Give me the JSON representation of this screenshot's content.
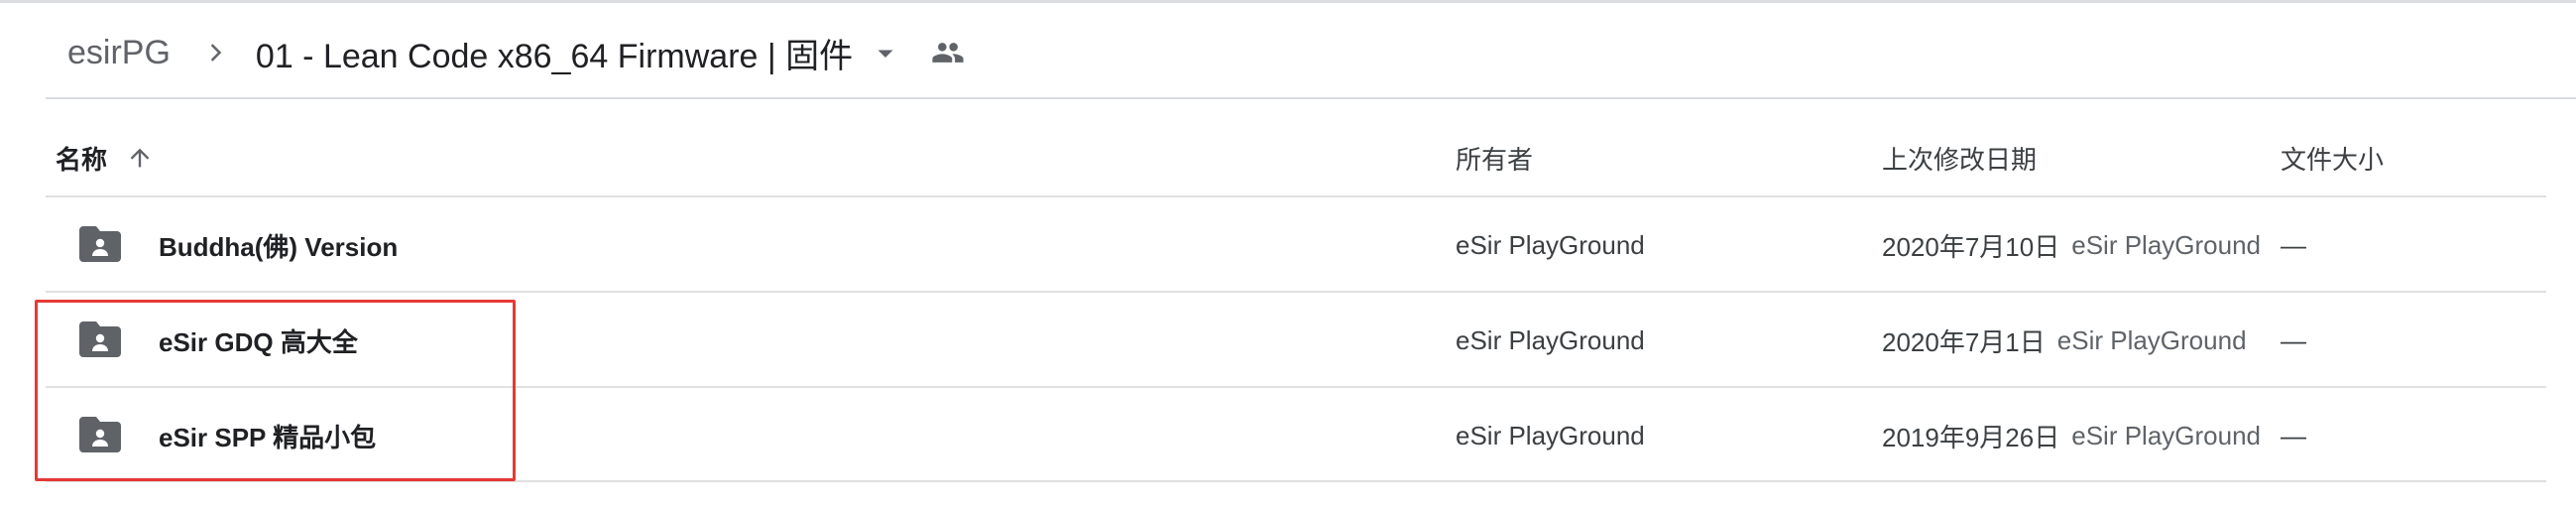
{
  "breadcrumb": {
    "root": "esirPG",
    "current": "01 - Lean Code x86_64 Firmware | 固件",
    "separator_icon": "chevron-right-icon",
    "dropdown_icon": "arrow-drop-down-icon",
    "shared_icon": "people-icon"
  },
  "columns": {
    "name": "名称",
    "name_sort_icon": "arrow-upward-icon",
    "owner": "所有者",
    "modified": "上次修改日期",
    "size": "文件大小"
  },
  "rows": [
    {
      "name": "Buddha(佛) Version",
      "owner": "eSir PlayGround",
      "modified_date": "2020年7月10日",
      "modified_by": "eSir PlayGround",
      "size": "—",
      "icon": "shared-folder-icon"
    },
    {
      "name": "eSir GDQ 高大全",
      "owner": "eSir PlayGround",
      "modified_date": "2020年7月1日",
      "modified_by": "eSir PlayGround",
      "size": "—",
      "icon": "shared-folder-icon"
    },
    {
      "name": "eSir SPP 精品小包",
      "owner": "eSir PlayGround",
      "modified_date": "2019年9月26日",
      "modified_by": "eSir PlayGround",
      "size": "—",
      "icon": "shared-folder-icon"
    }
  ],
  "annotation": {
    "color": "#e53935"
  },
  "colors": {
    "text": "#202124",
    "secondary": "#5f6368",
    "icon": "#5f6368",
    "divider": "#e0e0e0"
  }
}
